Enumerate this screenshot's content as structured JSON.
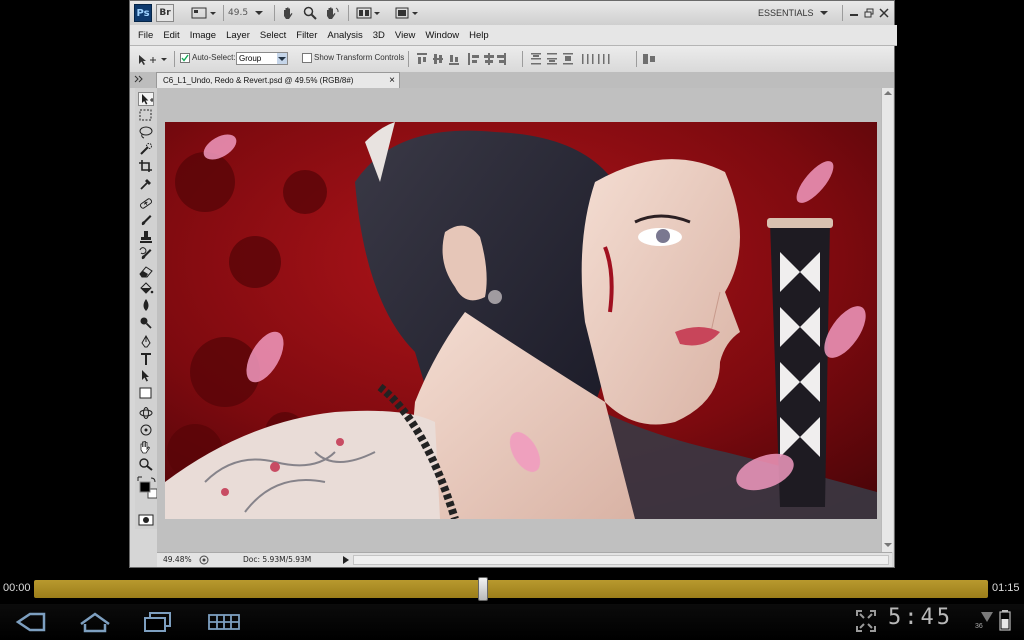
{
  "app": {
    "logo_ps": "Ps",
    "logo_br": "Br",
    "zoom_value": "49.5",
    "workspace": "ESSENTIALS"
  },
  "menu": [
    "File",
    "Edit",
    "Image",
    "Layer",
    "Select",
    "Filter",
    "Analysis",
    "3D",
    "View",
    "Window",
    "Help"
  ],
  "options": {
    "auto_select_label": "Auto-Select:",
    "auto_select_value": "Group",
    "show_transform_label": "Show Transform Controls"
  },
  "document": {
    "tab_title": "C6_L1_Undo, Redo & Revert.psd @ 49.5% (RGB/8#)",
    "tab_close": "×",
    "zoom_status": "49.48%",
    "doc_status": "Doc: 5.93M/5.93M"
  },
  "player": {
    "elapsed": "00:00",
    "duration": "01:15",
    "progress": 0.471
  },
  "system": {
    "clock": "5:45",
    "signal_label": "36"
  },
  "colors": {
    "seek_track": "#b8992e",
    "ps_blue": "#0e3a6e",
    "artwork_red": "#8c0a0e"
  },
  "icons": [
    "back-icon",
    "home-icon",
    "recent-apps-icon",
    "menu-grid-icon",
    "fullscreen-icon",
    "wifi-icon",
    "battery-icon",
    "move-tool-icon",
    "hand-icon",
    "zoom-icon",
    "rotate-view-icon"
  ]
}
